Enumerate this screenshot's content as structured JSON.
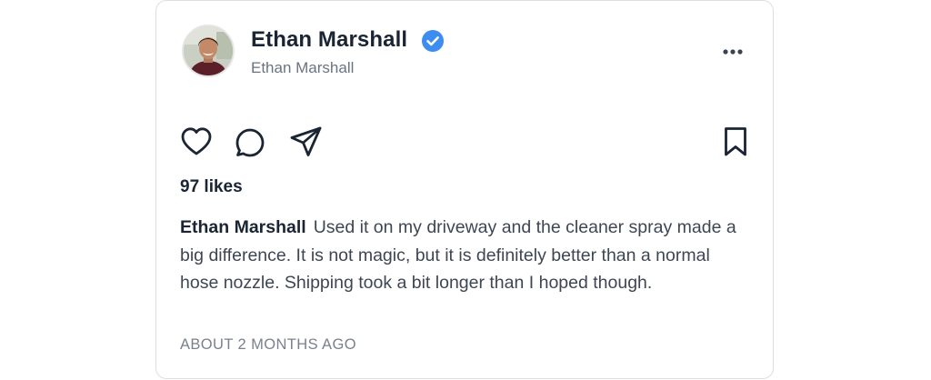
{
  "post": {
    "author_name": "Ethan Marshall",
    "author_handle": "Ethan Marshall",
    "verified": true,
    "likes_text": "97 likes",
    "caption_author": "Ethan Marshall",
    "caption_text": "Used it on my driveway and the cleaner spray made a big difference. It is not magic, but it is definitely better than a normal hose nozzle. Shipping took a bit longer than I hoped though.",
    "timestamp": "ABOUT 2 MONTHS AGO"
  },
  "icons": {
    "verified": "verified-badge-icon",
    "more": "more-horizontal-icon",
    "like": "heart-icon",
    "comment": "comment-icon",
    "share": "send-icon",
    "save": "bookmark-icon"
  },
  "colors": {
    "text_primary": "#1a2433",
    "text_secondary": "#6b7380",
    "verified_blue": "#3d8cf0",
    "border": "#dedede"
  }
}
